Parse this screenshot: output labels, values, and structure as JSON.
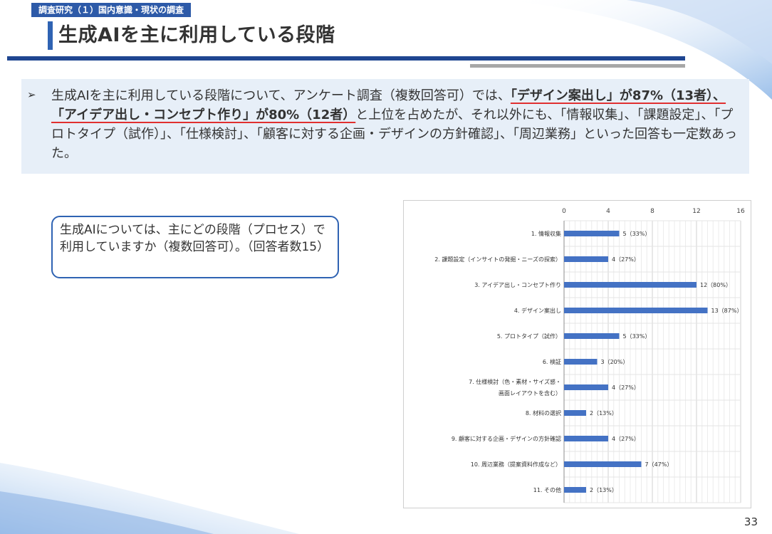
{
  "header": {
    "section_tag": "調査研究（１）国内意識・現状の調査",
    "title": "生成AIを主に利用している段階"
  },
  "summary": {
    "bullet": "➢",
    "text_1": "生成AIを主に利用している段階について、アンケート調査（複数回答可）では、",
    "highlight": "「デザイン案出し」が87%（13者）、「アイデア出し・コンセプト作り」が80%（12者）",
    "text_2": "と上位を占めたが、それ以外にも、「情報収集」、「課題設定」、「プロトタイプ（試作）」、「仕様検討」、「顧客に対する企画・デザインの方針確認」、「周辺業務」といった回答も一定数あった。"
  },
  "question": {
    "text": "生成AIについては、主にどの段階（プロセス）で利用していますか（複数回答可）。（回答者数15）"
  },
  "chart_data": {
    "type": "bar",
    "orientation": "horizontal",
    "categories": [
      "1. 情報収集",
      "2. 課題設定（インサイトの発掘・ニーズの探索）",
      "3. アイデア出し・コンセプト作り",
      "4. デザイン案出し",
      "5. プロトタイプ（試作）",
      "6. 検証",
      "7. 仕様検討（色・素材・サイズ感・|画面レイアウトを含む）",
      "8. 材料の選択",
      "9. 顧客に対する企画・デザインの方針確認",
      "10. 周辺業務（提案資料作成など）",
      "11. その他"
    ],
    "values": [
      5,
      4,
      12,
      13,
      5,
      3,
      4,
      2,
      4,
      7,
      2
    ],
    "data_labels": [
      "5（33%）",
      "4（27%）",
      "12（80%）",
      "13（87%）",
      "5（33%）",
      "3（20%）",
      "4（27%）",
      "2（13%）",
      "4（27%）",
      "7（47%）",
      "2（13%）"
    ],
    "xlim": [
      0,
      16
    ],
    "xticks": [
      "0",
      "4",
      "8",
      "12",
      "16"
    ],
    "grid": true,
    "bar_color": "#4472c4"
  },
  "footer": {
    "page_number": "33"
  }
}
